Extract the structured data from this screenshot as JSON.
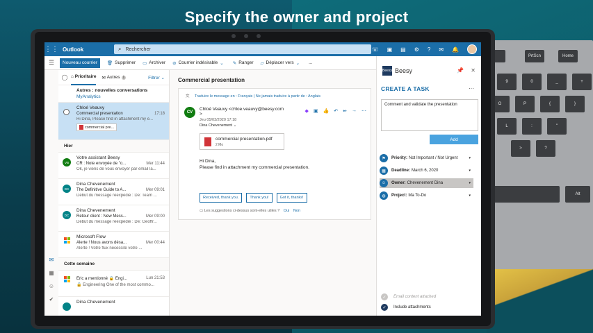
{
  "headline": "Specify the owner and project",
  "keyboard": {
    "keys": [
      "PrtScn",
      "Home",
      "Alt"
    ]
  },
  "topbar": {
    "app_title": "Outlook",
    "search_placeholder": "Rechercher"
  },
  "cmdbar": {
    "new_mail": "Nouveau courrier",
    "delete": "Supprimer",
    "archive": "Archiver",
    "junk": "Courrier indésirable",
    "sweep": "Ranger",
    "move": "Déplacer vers",
    "more": "..."
  },
  "list": {
    "tab_focused": "Prioritaire",
    "tab_other": "Autres",
    "other_count": "1",
    "filter": "Filtrer",
    "notice_title": "Autres : nouvelles conversations",
    "notice_sub": "MyAnalytics",
    "group_yesterday": "Hier",
    "group_week": "Cette semaine",
    "messages": [
      {
        "from": "Chloé Veauvy",
        "subject": "Commercial presentation",
        "time": "17:18",
        "preview": "Hi Dina, Please find in attachment my e...",
        "attachment": "commercial pre..."
      },
      {
        "initials": "VB",
        "from": "Votre assistant Beesy",
        "subject": "CR : Note envoyée de \"o...",
        "time": "Mer 11:44",
        "preview": "Ok, je viens de vous envoyer par email la..."
      },
      {
        "initials": "DC",
        "from": "Dina Chevenement",
        "subject": "The Definitive Guide to A...",
        "time": "Mer 09:01",
        "preview": "Début du message réexpédié : De: Team ..."
      },
      {
        "initials": "DC",
        "from": "Dina Chevenement",
        "subject": "Retour client : New Mess...",
        "time": "Mer 09:00",
        "preview": "Début du message réexpédié : De: Geoffr..."
      },
      {
        "from": "Microsoft Flow",
        "subject": "Alerte ! Nous avons désa...",
        "time": "Mer 00:44",
        "preview": "Alerte ! Votre flux nécessite votre ..."
      },
      {
        "from": "Eric a mentionné 🔒 Engi...",
        "subject": "",
        "time": "Lun 21:53",
        "preview": "🔒 Engineering One of the most commo..."
      },
      {
        "from": "Dina Chevenement",
        "subject": "",
        "time": "",
        "preview": ""
      }
    ]
  },
  "reading": {
    "subject": "Commercial presentation",
    "translate": "Traduire le message en : Français",
    "never_translate": "Ne jamais traduire à partir de : Anglais",
    "sender_initials": "CV",
    "sender": "Chloé Veauvy <chloe.veauvy@beesy.com",
    "sender_close": ">",
    "date": "Jeu 05/03/2020 17:18",
    "to": "Dina Chevenement",
    "attachment_name": "commercial presentation.pdf",
    "attachment_size": "2 Mo",
    "greeting": "Hi Dina,",
    "body": "Please find in attachment my commercial presentation.",
    "replies": [
      "Received, thank you.",
      "Thank you!",
      "Got it, thanks!"
    ],
    "helpful_q": "Les suggestions ci-dessus sont-elles utiles ?",
    "yes": "Oui",
    "no": "Non"
  },
  "beesy": {
    "brand": "Beesy",
    "logo_text": "Beesy",
    "title": "CREATE A TASK",
    "more": "···",
    "task_text": "Comment and validate the presentation",
    "add": "Add",
    "priority_label": "Priority:",
    "priority_value": "Not Important / Not Urgent",
    "deadline_label": "Deadline:",
    "deadline_value": "March 6, 2020",
    "owner_label": "Owner:",
    "owner_value": "Chevenement Dina",
    "project_label": "Project:",
    "project_value": "Ma To-Do",
    "email_content": "Email content attached",
    "include_attachments": "Include attachments"
  },
  "colors": {
    "accent": "#1b6ea8",
    "selected": "#c7e0f4",
    "sender_avatar": "#107c10"
  }
}
